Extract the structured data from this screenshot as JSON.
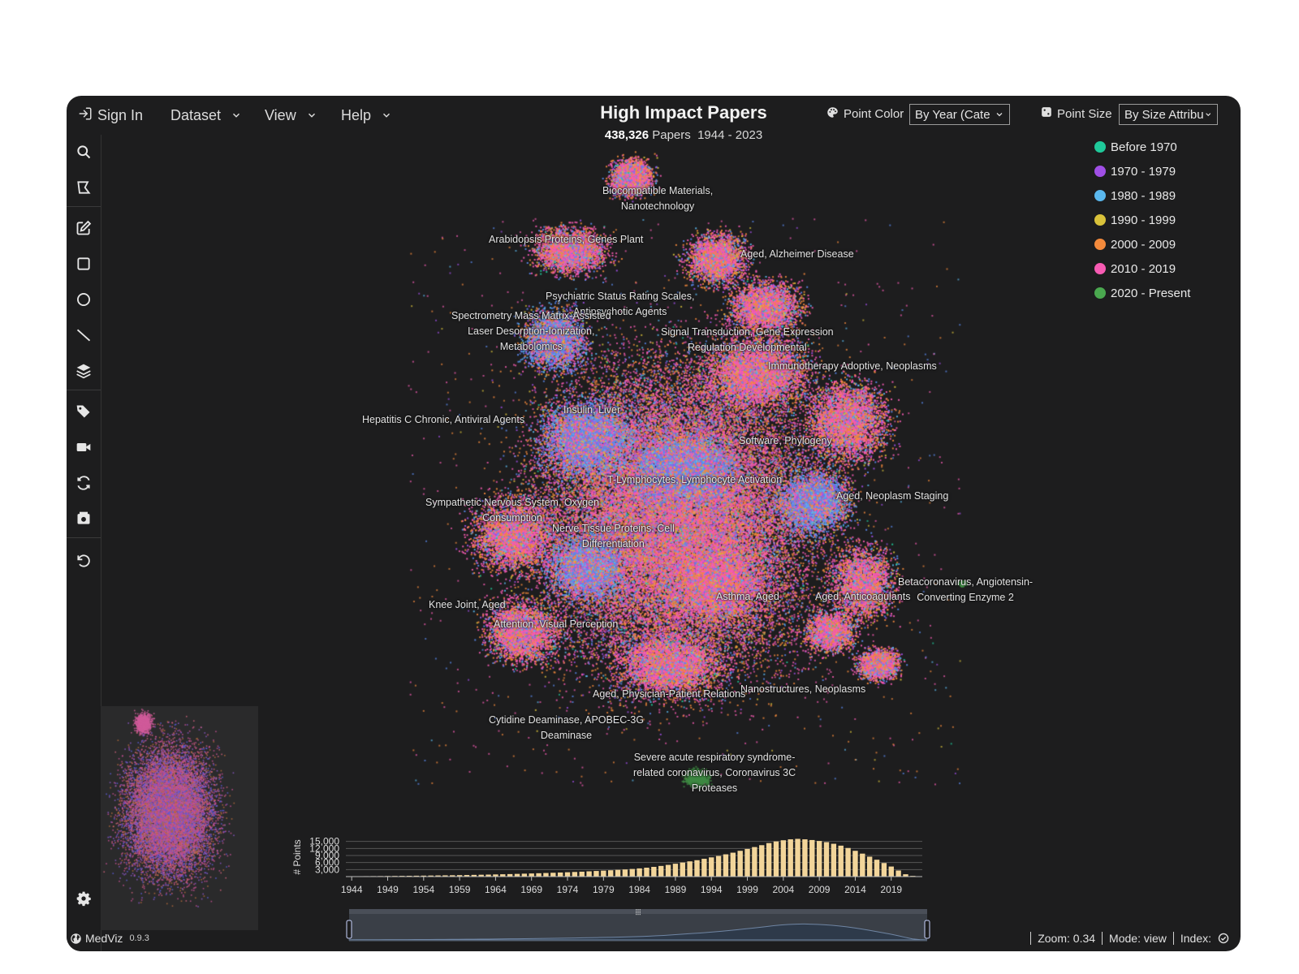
{
  "topbar": {
    "sign_in": "Sign In",
    "menus": [
      "Dataset",
      "View",
      "Help"
    ],
    "title": "High Impact Papers",
    "paper_count": "438,326",
    "papers_word": "Papers",
    "year_range": "1944 - 2023",
    "point_color_label": "Point Color",
    "point_color_value": "By Year (Cate",
    "point_size_label": "Point Size",
    "point_size_value": "By Size Attribu"
  },
  "sidebar": {
    "tools": [
      "search-icon",
      "lasso-select-icon",
      "edit-icon",
      "rectangle-icon",
      "circle-icon",
      "line-icon",
      "layers-icon",
      "tags-icon",
      "video-icon",
      "refresh-icon",
      "snapshot-icon",
      "undo-icon"
    ],
    "bottom_tool": "gear-icon"
  },
  "legend": [
    {
      "label": "Before 1970",
      "color": "#1fc99a"
    },
    {
      "label": "1970 - 1979",
      "color": "#a04fe6"
    },
    {
      "label": "1980 - 1989",
      "color": "#5ab8ee"
    },
    {
      "label": "1990 - 1999",
      "color": "#d9c23a"
    },
    {
      "label": "2000 - 2009",
      "color": "#f48a3c"
    },
    {
      "label": "2010 - 2019",
      "color": "#f75bb3"
    },
    {
      "label": "2020 - Present",
      "color": "#4aa84f"
    }
  ],
  "cluster_labels": [
    {
      "lines": [
        "Biocompatible Materials,",
        "Nanotechnology"
      ]
    },
    {
      "lines": [
        "Arabidopsis Proteins, Genes Plant"
      ]
    },
    {
      "lines": [
        "Aged, Alzheimer Disease"
      ]
    },
    {
      "lines": [
        "Psychiatric Status Rating Scales,",
        "Antipsychotic Agents"
      ]
    },
    {
      "lines": [
        "Spectrometry Mass Matrix-Assisted",
        "Laser Desorption-Ionization,",
        "Metabolomics"
      ]
    },
    {
      "lines": [
        "Signal Transduction, Gene Expression",
        "Regulation Developmental"
      ]
    },
    {
      "lines": [
        "Immunotherapy Adoptive, Neoplasms"
      ]
    },
    {
      "lines": [
        "Insulin, Liver"
      ]
    },
    {
      "lines": [
        "Hepatitis C Chronic, Antiviral Agents"
      ]
    },
    {
      "lines": [
        "Software, Phylogeny"
      ]
    },
    {
      "lines": [
        "T-Lymphocytes, Lymphocyte Activation"
      ]
    },
    {
      "lines": [
        "Aged, Neoplasm Staging"
      ]
    },
    {
      "lines": [
        "Sympathetic Nervous System, Oxygen",
        "Consumption"
      ]
    },
    {
      "lines": [
        "Nerve Tissue Proteins, Cell",
        "Differentiation"
      ]
    },
    {
      "lines": [
        "Betacoronavirus, Angiotensin-",
        "Converting Enzyme 2"
      ]
    },
    {
      "lines": [
        "Asthma, Aged"
      ]
    },
    {
      "lines": [
        "Aged, Anticoagulants"
      ]
    },
    {
      "lines": [
        "Knee Joint, Aged"
      ]
    },
    {
      "lines": [
        "Attention, Visual Perception"
      ]
    },
    {
      "lines": [
        "Nanostructures, Neoplasms"
      ]
    },
    {
      "lines": [
        "Aged, Physician-Patient Relations"
      ]
    },
    {
      "lines": [
        "Cytidine Deaminase, APOBEC-3G",
        "Deaminase"
      ]
    },
    {
      "lines": [
        "Severe acute respiratory syndrome-",
        "related coronavirus, Coronavirus 3C",
        "Proteases"
      ]
    }
  ],
  "chart_data": {
    "type": "bar",
    "ylabel": "# Points",
    "y_ticks": [
      "15,000",
      "12,000",
      "9,000",
      "6,000",
      "3,000"
    ],
    "y_tick_values": [
      15000,
      12000,
      9000,
      6000,
      3000
    ],
    "ylim": [
      0,
      18000
    ],
    "x_ticks": [
      "1944",
      "1949",
      "1954",
      "1959",
      "1964",
      "1969",
      "1974",
      "1979",
      "1984",
      "1989",
      "1994",
      "1999",
      "2004",
      "2009",
      "2014",
      "2019"
    ],
    "x_start": 1944,
    "values": [
      150,
      170,
      190,
      210,
      230,
      260,
      290,
      320,
      350,
      380,
      420,
      460,
      500,
      540,
      580,
      630,
      680,
      740,
      800,
      860,
      930,
      1000,
      1080,
      1160,
      1250,
      1340,
      1440,
      1540,
      1640,
      1750,
      1860,
      1980,
      2100,
      2250,
      2400,
      2550,
      2700,
      2880,
      3050,
      3250,
      3500,
      3800,
      4150,
      4550,
      5000,
      5500,
      6000,
      6500,
      7000,
      7600,
      8200,
      8800,
      9500,
      10200,
      11000,
      11800,
      12600,
      13400,
      14300,
      15000,
      15500,
      15900,
      16100,
      15900,
      15600,
      15200,
      14700,
      14000,
      13200,
      12200,
      11000,
      9800,
      8500,
      7200,
      5800,
      4300,
      2600,
      1000,
      300
    ],
    "bar_color": "#f2d59a"
  },
  "statusbar": {
    "brand": "MedViz",
    "version": "0.9.3",
    "zoom": "Zoom: 0.34",
    "mode": "Mode: view",
    "index": "Index:"
  }
}
